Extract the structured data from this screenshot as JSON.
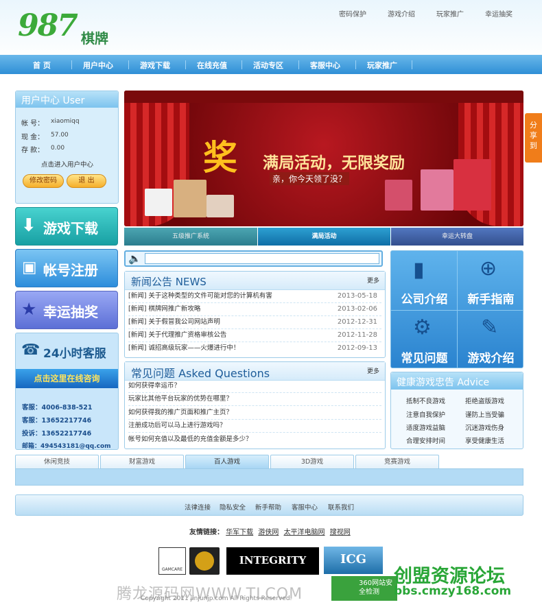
{
  "logo": {
    "number": "987",
    "text": "棋牌"
  },
  "toplinks": [
    "密码保护",
    "游戏介绍",
    "玩家推广",
    "幸运抽奖"
  ],
  "nav": [
    "首 页",
    "用户中心",
    "游戏下载",
    "在线充值",
    "活动专区",
    "客服中心",
    "玩家推广"
  ],
  "user": {
    "title": "用户中心 User",
    "account_label": "帐 号：",
    "account": "xiaomiqq",
    "cash_label": "现 金：",
    "cash": "57.00",
    "bank_label": "存 款：",
    "bank": "0.00",
    "enter": "点击进入用户中心",
    "change_pwd": "修改密码",
    "logout": "退 出"
  },
  "side_buttons": {
    "download": "游戏下载",
    "register": "帐号注册",
    "lottery": "幸运抽奖",
    "service": "24小时客服",
    "online": "点击这里在线咨询"
  },
  "contact": {
    "kf1": "客服：4006-838-521",
    "kf2": "客服：13652217746",
    "complaint": "投诉：13652217746",
    "mail": "邮箱：494543181@qq.com"
  },
  "banner": {
    "big": "奖",
    "title": "满局活动，无限奖励",
    "sub": "亲，你今天领了没？"
  },
  "banner_tabs": [
    "五级推广系统",
    "满局活动",
    "幸运大转盘"
  ],
  "news": {
    "title": "新闻公告 NEWS",
    "more": "更多",
    "items": [
      {
        "text": "[新闻] 关于这种类型的文件可能对您的计算机有害",
        "date": "2013-05-18"
      },
      {
        "text": "[新闻] 棋牌网推广新攻略",
        "date": "2013-02-06"
      },
      {
        "text": "[新闻] 关于假冒我公司网站声明",
        "date": "2012-12-31"
      },
      {
        "text": "[新闻] 关于代理推广资格审核公告",
        "date": "2012-11-28"
      },
      {
        "text": "[新闻] 诚招高级玩家——火爆进行中！",
        "date": "2012-09-13"
      }
    ]
  },
  "faq": {
    "title": "常见问题 Asked Questions",
    "more": "更多",
    "items": [
      "如何获得幸运币？",
      "玩家比其他平台玩家的优势在哪里？",
      "如何获得我的推广页面和推广主页？",
      "注册成功后可以马上进行游戏吗？",
      "帐号如何充值以及最低的充值金额是多少？"
    ]
  },
  "grid": [
    "公司介绍",
    "新手指南",
    "常见问题",
    "游戏介绍"
  ],
  "advice": {
    "title": "健康游戏忠告 Advice",
    "items": [
      "抵制不良游戏",
      "拒绝盗版游戏",
      "注意自我保护",
      "谨防上当受骗",
      "适度游戏益脑",
      "沉迷游戏伤身",
      "合理安排时间",
      "享受健康生活"
    ]
  },
  "game_tabs": [
    "休闲竞技",
    "财富游戏",
    "百人游戏",
    "3D游戏",
    "竞赛游戏"
  ],
  "footer_links": [
    "法律连接",
    "隐私安全",
    "新手帮助",
    "客服中心",
    "联系我们"
  ],
  "friends": {
    "label": "友情链接：",
    "items": [
      "华军下载",
      "游侠网",
      "太平洋电脑网",
      "搜视网"
    ]
  },
  "partner_logos": [
    "GAMCARE",
    "INTEGRITY",
    "ICG",
    "360网站安全检测"
  ],
  "copyright": "Copyright 2011 jinjunjp.com All Rights Reserved.",
  "watermark": {
    "left": "腾龙源码网WWW.TLCOM",
    "right_top": "创盟资源论坛",
    "right_bottom": "bbs.cmzy168.com"
  },
  "share": "分享到"
}
